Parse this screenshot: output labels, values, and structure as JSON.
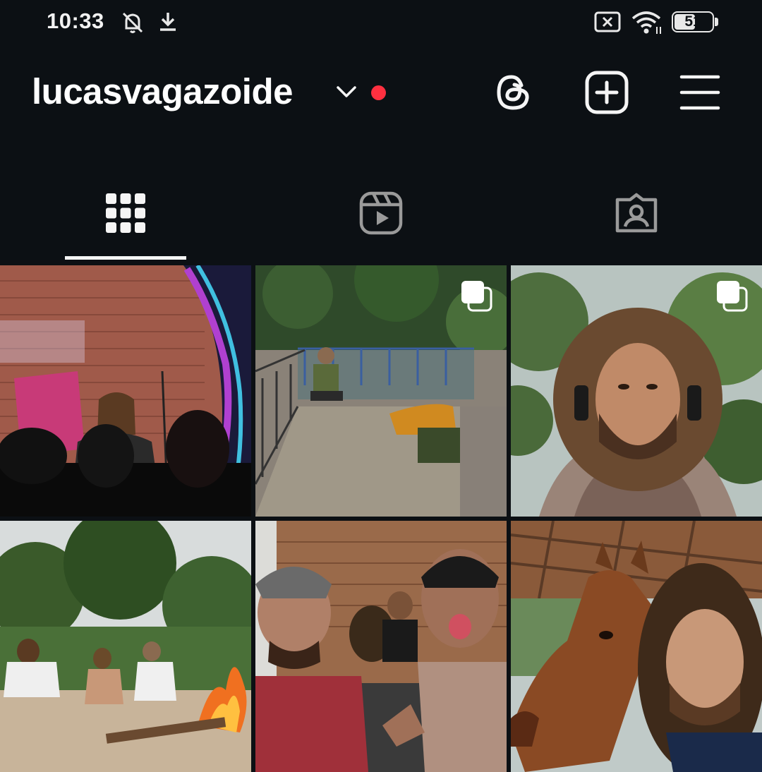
{
  "status_bar": {
    "time": "10:33",
    "battery": "51",
    "icons": [
      "bell-off-icon",
      "download-icon",
      "no-sim-icon",
      "wifi-icon",
      "battery-icon"
    ]
  },
  "header": {
    "username": "lucasvagazoide",
    "icons": [
      "chevron-down-icon",
      "threads-icon",
      "add-post-icon",
      "menu-icon"
    ],
    "notification_dot_color": "#ff3040"
  },
  "tabs": [
    {
      "icon": "grid-icon",
      "selected": true
    },
    {
      "icon": "reels-icon",
      "selected": false
    },
    {
      "icon": "tagged-icon",
      "selected": false
    }
  ],
  "posts": [
    {
      "index": 1,
      "multiple": false
    },
    {
      "index": 2,
      "multiple": true
    },
    {
      "index": 3,
      "multiple": true
    },
    {
      "index": 4,
      "multiple": false
    },
    {
      "index": 5,
      "multiple": false
    },
    {
      "index": 6,
      "multiple": false
    }
  ],
  "colors": {
    "background": "#0c1014",
    "text": "#f5f5f5",
    "accent_red": "#ff3040"
  }
}
